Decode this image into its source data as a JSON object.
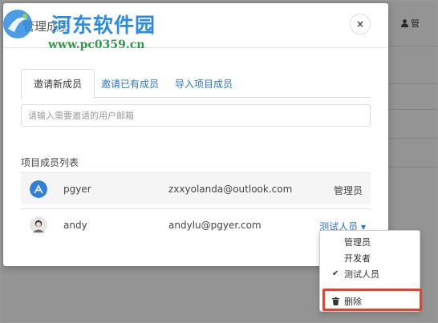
{
  "background": {
    "user_label": "管"
  },
  "watermark": {
    "name": "河东软件园",
    "url": "www.pc0359.cn"
  },
  "modal": {
    "title": "管理成员",
    "close_label": "×",
    "tabs": [
      {
        "label": "邀请新成员",
        "active": true
      },
      {
        "label": "邀请已有成员",
        "active": false
      },
      {
        "label": "导入项目成员",
        "active": false
      }
    ],
    "email_input": {
      "placeholder": "请输入需要邀请的用户邮箱",
      "value": ""
    },
    "member_list_label": "项目成员列表",
    "members": [
      {
        "name": "pgyer",
        "email": "zxxyolanda@outlook.com",
        "role": "管理员"
      },
      {
        "name": "andy",
        "email": "andylu@pgyer.com",
        "role": "测试人员",
        "role_caret": "▾"
      }
    ]
  },
  "role_dropdown": {
    "options": [
      {
        "label": "管理员",
        "checked": false
      },
      {
        "label": "开发者",
        "checked": false
      },
      {
        "label": "测试人员",
        "checked": true
      }
    ],
    "check_mark": "✔",
    "delete_label": "删除"
  },
  "colors": {
    "link": "#2a75c6",
    "highlight": "#e1452d",
    "watermark_blue": "#2b8be2",
    "watermark_green": "#2f9a4a"
  }
}
